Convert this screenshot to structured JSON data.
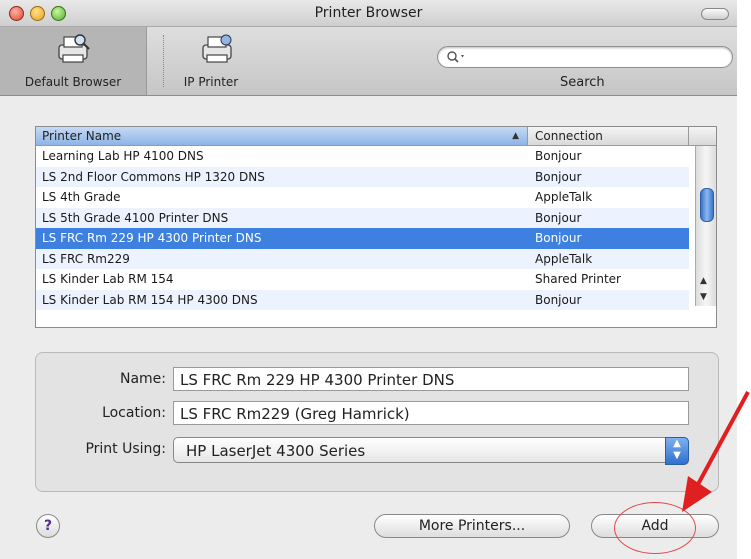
{
  "window": {
    "title": "Printer Browser"
  },
  "toolbar": {
    "items": [
      {
        "label": "Default Browser",
        "icon": "printer-magnifier-icon"
      },
      {
        "label": "IP Printer",
        "icon": "ip-printer-icon"
      }
    ],
    "search_label": "Search",
    "search_placeholder": ""
  },
  "table": {
    "headers": {
      "name": "Printer Name",
      "connection": "Connection"
    },
    "rows": [
      {
        "name": "Learning Lab HP 4100 DNS",
        "connection": "Bonjour"
      },
      {
        "name": "LS 2nd Floor Commons HP 1320 DNS",
        "connection": "Bonjour"
      },
      {
        "name": "LS 4th Grade",
        "connection": "AppleTalk"
      },
      {
        "name": "LS 5th Grade 4100 Printer DNS",
        "connection": "Bonjour"
      },
      {
        "name": "LS FRC Rm 229 HP 4300 Printer DNS",
        "connection": "Bonjour",
        "selected": true
      },
      {
        "name": "LS FRC Rm229",
        "connection": "AppleTalk"
      },
      {
        "name": "LS Kinder Lab RM 154",
        "connection": "Shared Printer"
      },
      {
        "name": "LS Kinder Lab RM 154 HP 4300 DNS",
        "connection": "Bonjour"
      }
    ]
  },
  "form": {
    "name_label": "Name:",
    "name_value": "LS FRC Rm 229 HP 4300 Printer DNS",
    "location_label": "Location:",
    "location_value": "LS FRC Rm229 (Greg Hamrick)",
    "print_using_label": "Print Using:",
    "print_using_value": "HP LaserJet 4300 Series"
  },
  "footer": {
    "help_label": "?",
    "more_printers_label": "More Printers...",
    "add_label": "Add"
  },
  "colors": {
    "selection": "#3d80df",
    "annotation_red": "#e02020"
  }
}
